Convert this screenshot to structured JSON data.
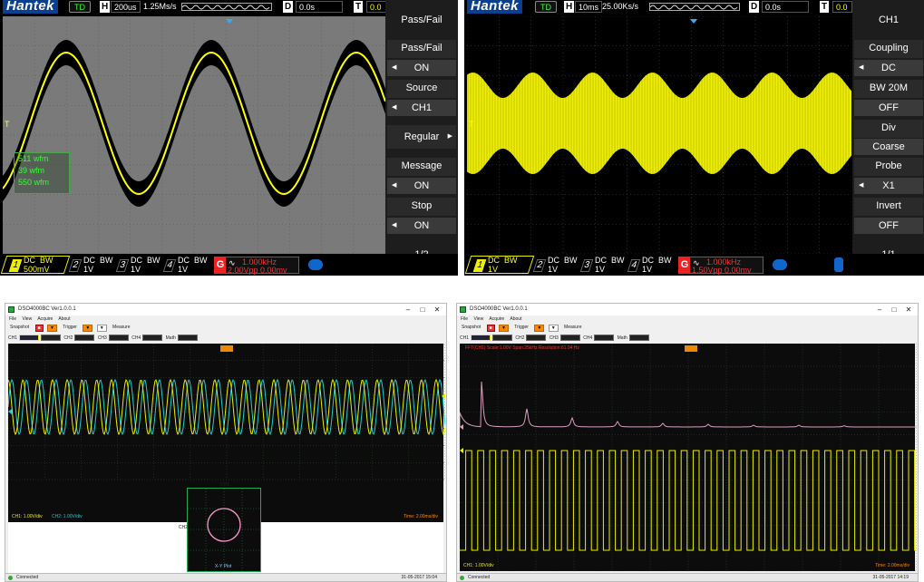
{
  "scope1": {
    "brand": "Hantek",
    "td": "TD",
    "h_label": "H",
    "timebase": "200us",
    "sample_rate": "1.25Ms/s",
    "d_label": "D",
    "delay": "0.0s",
    "t_label": "T",
    "trigger_level": "0.0",
    "stats": [
      "511 wfm",
      "39 wfm",
      "550 wfm"
    ],
    "menu": {
      "title": "Pass/Fail",
      "items": [
        {
          "label": "Pass/Fail",
          "value": "ON"
        },
        {
          "label": "Source",
          "value": "CH1"
        },
        {
          "label": "Regular",
          "value": ""
        },
        {
          "label": "Message",
          "value": "ON"
        },
        {
          "label": "Stop",
          "value": "ON"
        }
      ],
      "page": "1/2"
    },
    "channels": [
      {
        "num": "1",
        "coupling": "DC",
        "bw": "BW",
        "scale": "500mV"
      },
      {
        "num": "2",
        "coupling": "DC",
        "bw": "BW",
        "scale": "1V"
      },
      {
        "num": "3",
        "coupling": "DC",
        "bw": "BW",
        "scale": "1V"
      },
      {
        "num": "4",
        "coupling": "DC",
        "bw": "BW",
        "scale": "1V"
      }
    ],
    "gen": {
      "label": "G",
      "freq": "1.000kHz",
      "amp": "2.00Vpp 0.00mv"
    }
  },
  "scope2": {
    "brand": "Hantek",
    "td": "TD",
    "h_label": "H",
    "timebase": "10ms",
    "sample_rate": "25.00Ks/s",
    "d_label": "D",
    "delay": "0.0s",
    "t_label": "T",
    "trigger_level": "0.0",
    "menu": {
      "title": "CH1",
      "items": [
        {
          "label": "Coupling",
          "value": "DC"
        },
        {
          "label": "BW 20M",
          "value": "OFF"
        },
        {
          "label": "Div",
          "value": "Coarse"
        },
        {
          "label": "Probe",
          "value": "X1"
        },
        {
          "label": "Invert",
          "value": "OFF"
        }
      ],
      "page": "1/1"
    },
    "channels": [
      {
        "num": "1",
        "coupling": "DC",
        "bw": "BW",
        "scale": "1V"
      },
      {
        "num": "2",
        "coupling": "DC",
        "bw": "BW",
        "scale": "1V"
      },
      {
        "num": "3",
        "coupling": "DC",
        "bw": "BW",
        "scale": "1V"
      },
      {
        "num": "4",
        "coupling": "DC",
        "bw": "BW",
        "scale": "1V"
      }
    ],
    "gen": {
      "label": "G",
      "freq": "1.000kHz",
      "amp": "1.50Vpp 0.00mv"
    }
  },
  "app1": {
    "title": "DSO4000BC Ver1.0.0.1",
    "menus": [
      "File",
      "View",
      "Acquire",
      "About"
    ],
    "toolbar": [
      "Snapshot",
      "Trigger",
      "Measure"
    ],
    "ch_row": [
      "CH1",
      "CH2",
      "CH3",
      "CH4",
      "Math"
    ],
    "trig_marker": "CH1",
    "readout_left": "CH1: 1.00V/div",
    "readout_ch2": "CH2: 1.00V/div",
    "readout_time": "Time: 2.00ms/div",
    "xy_label": "X-Y Plot",
    "xy_axis_x": "CH2",
    "xy_axis_y": "CH1",
    "status": "Connected",
    "datetime": "31-05-2017 15:04"
  },
  "app2": {
    "title": "DSO4000BC Ver1.0.0.1",
    "menus": [
      "File",
      "View",
      "Acquire",
      "About"
    ],
    "toolbar": [
      "Snapshot",
      "Trigger",
      "Measure"
    ],
    "ch_row": [
      "CH1",
      "CH2",
      "CH3",
      "CH4",
      "Math"
    ],
    "fft_header": "FFT(CH1)  Scale:1.00V  Span:25kHz  Resolution:61.04 Hz",
    "readout_left": "CH1: 1.00V/div",
    "readout_time": "Time: 2.00ms/div",
    "status": "Connected",
    "datetime": "31-05-2017 14:19"
  },
  "colors": {
    "trace_yellow": "#ffff00",
    "trace_cyan": "#22cccc",
    "fft_pink": "#e0a0c0",
    "grid": "#3a5a3a"
  }
}
